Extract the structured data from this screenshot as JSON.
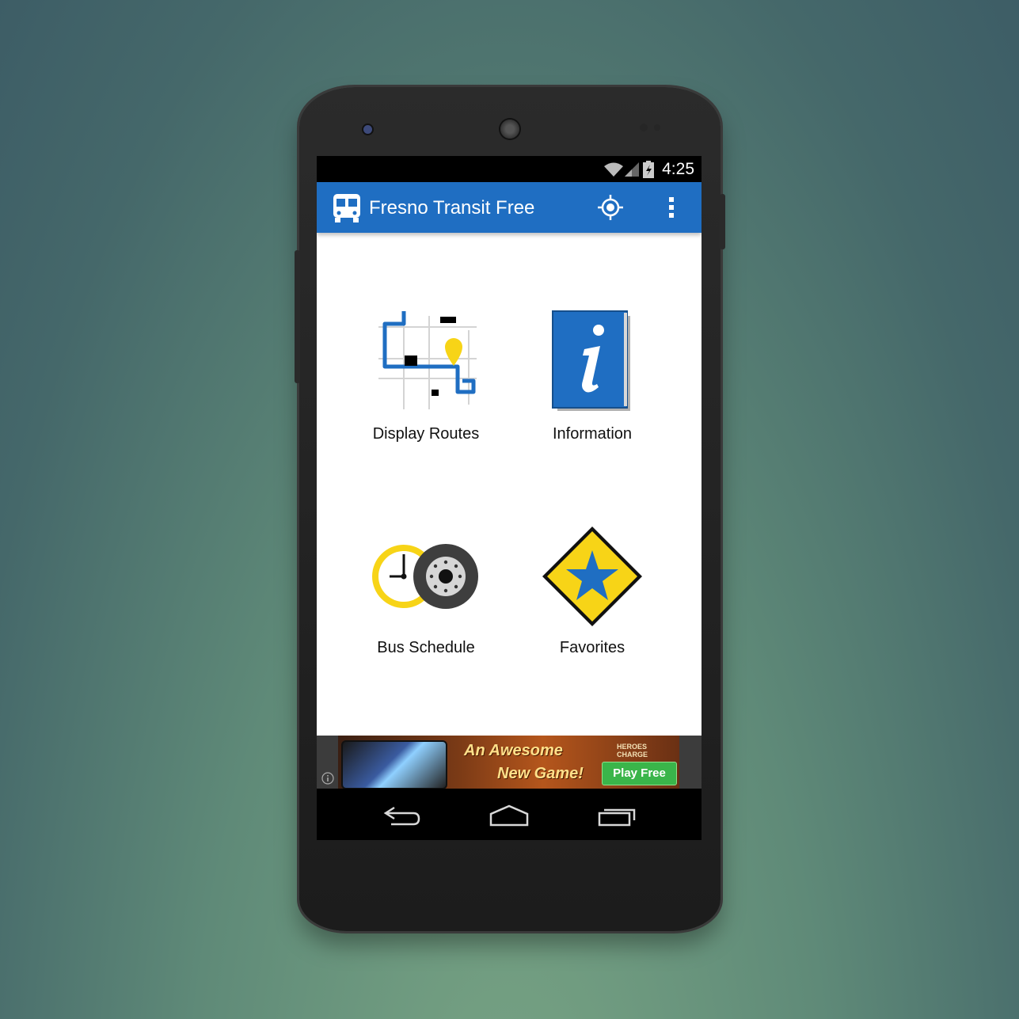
{
  "status_bar": {
    "time": "4:25"
  },
  "app_bar": {
    "title": "Fresno Transit Free",
    "icons": [
      "bus-icon",
      "locate-icon",
      "overflow-menu-icon"
    ]
  },
  "menu": {
    "items": [
      {
        "label": "Display Routes",
        "icon": "route-map-icon"
      },
      {
        "label": "Information",
        "icon": "info-book-icon"
      },
      {
        "label": "Bus Schedule",
        "icon": "clock-wheel-icon"
      },
      {
        "label": "Favorites",
        "icon": "star-sign-icon"
      }
    ]
  },
  "ad": {
    "headline_line1": "An Awesome",
    "headline_line2": "New Game!",
    "button": "Play Free",
    "brand": "HEROES CHARGE"
  },
  "nav_bar": {
    "icons": [
      "back-icon",
      "home-icon",
      "recents-icon"
    ]
  },
  "colors": {
    "app_bar": "#1f6ec2",
    "accent_yellow": "#f7d417",
    "background": "#ffffff"
  }
}
